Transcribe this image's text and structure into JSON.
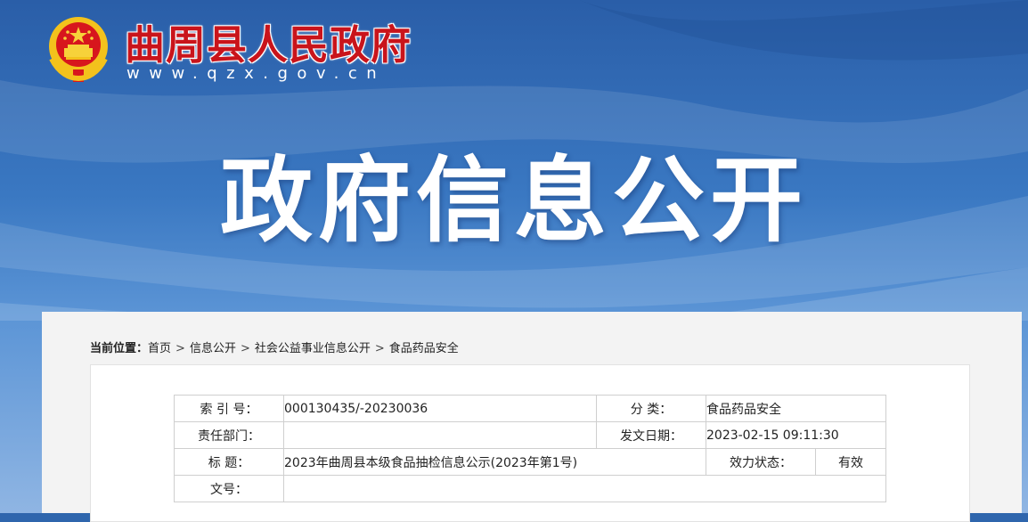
{
  "header": {
    "site_name": "曲周县人民政府",
    "site_url": "www.qzx.gov.cn",
    "banner_title": "政府信息公开",
    "emblem_icon": "national-emblem-icon"
  },
  "breadcrumb": {
    "label": "当前位置：",
    "items": [
      "首页",
      "信息公开",
      "社会公益事业信息公开",
      "食品药品安全"
    ],
    "separator": ">"
  },
  "meta": {
    "index_label": "索 引 号：",
    "index_value": "000130435/-20230036",
    "category_label": "分 类：",
    "category_value": "食品药品安全",
    "department_label": "责任部门：",
    "department_value": "",
    "date_label": "发文日期：",
    "date_value": "2023-02-15 09:11:30",
    "title_label": "标 题：",
    "title_value": "2023年曲周县本级食品抽检信息公示(2023年第1号)",
    "status_label": "效力状态：",
    "status_value": "有效",
    "docno_label": "文号：",
    "docno_value": ""
  },
  "colors": {
    "brand_red": "#c9141b",
    "banner_blue": "#2f66ad"
  }
}
